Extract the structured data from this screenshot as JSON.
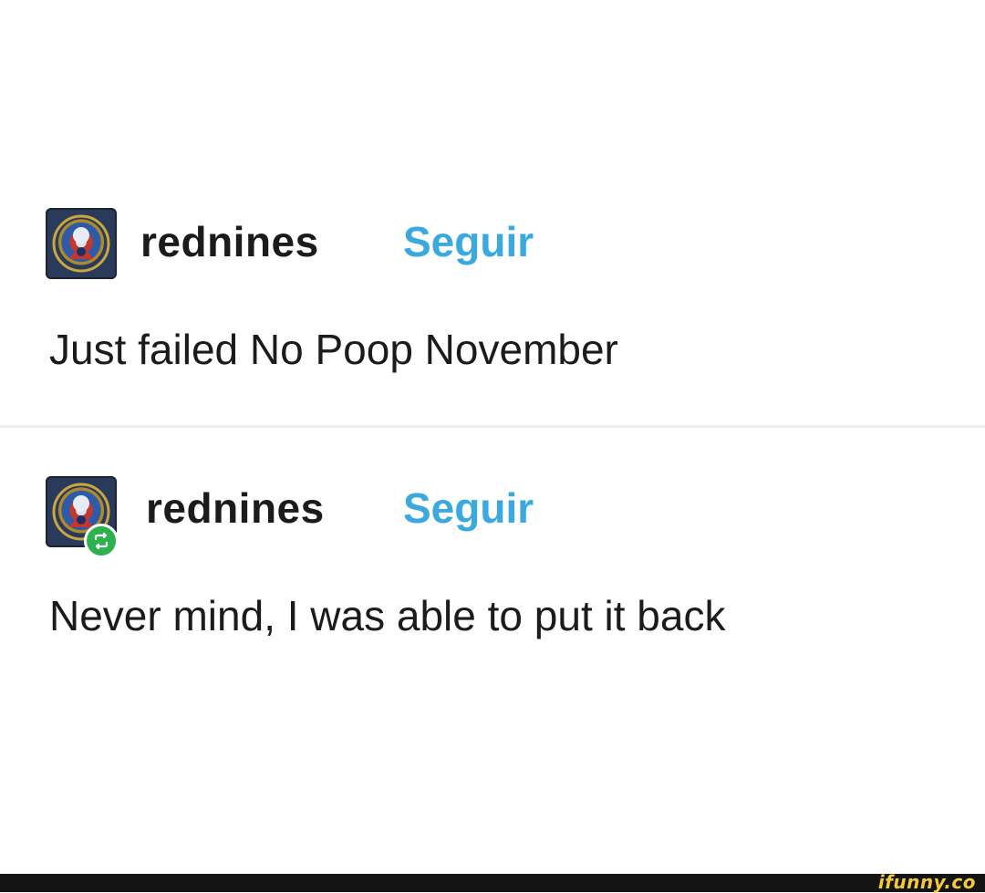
{
  "posts": [
    {
      "username": "rednines",
      "follow_label": "Seguir",
      "text": "Just failed No Poop November",
      "is_reblog": false
    },
    {
      "username": "rednines",
      "follow_label": "Seguir",
      "text": "Never mind, I was able to put it back",
      "is_reblog": true
    }
  ],
  "icons": {
    "reblog": "reblog-icon"
  },
  "colors": {
    "follow": "#3aa9e0",
    "reblog_badge": "#2bb24c",
    "text": "#1b1b1b"
  },
  "watermark": "ifunny.co"
}
